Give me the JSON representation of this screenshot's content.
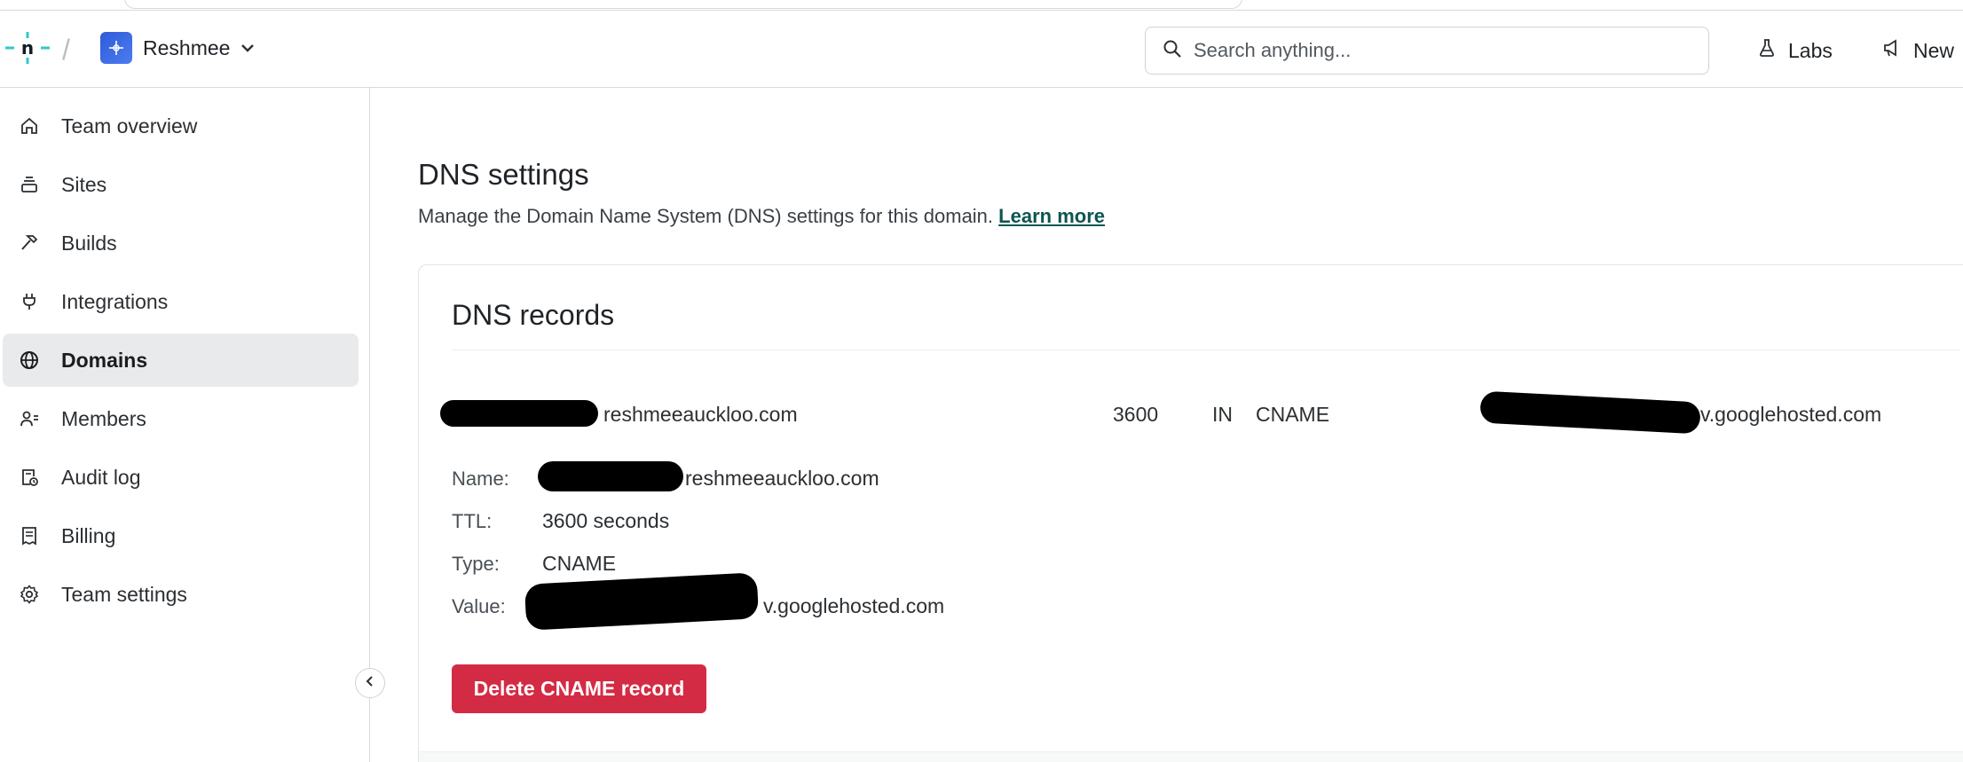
{
  "header": {
    "team_name": "Reshmee",
    "search_placeholder": "Search anything...",
    "labs_label": "Labs",
    "news_label": "New"
  },
  "sidebar": {
    "items": [
      {
        "label": "Team overview",
        "icon": "home-icon",
        "active": false
      },
      {
        "label": "Sites",
        "icon": "stack-icon",
        "active": false
      },
      {
        "label": "Builds",
        "icon": "hammer-icon",
        "active": false
      },
      {
        "label": "Integrations",
        "icon": "plug-icon",
        "active": false
      },
      {
        "label": "Domains",
        "icon": "globe-icon",
        "active": true
      },
      {
        "label": "Members",
        "icon": "members-icon",
        "active": false
      },
      {
        "label": "Audit log",
        "icon": "audit-log-icon",
        "active": false
      },
      {
        "label": "Billing",
        "icon": "receipt-icon",
        "active": false
      },
      {
        "label": "Team settings",
        "icon": "gear-icon",
        "active": false
      }
    ]
  },
  "main": {
    "title": "DNS settings",
    "description": "Manage the Domain Name System (DNS) settings for this domain.",
    "learn_more": "Learn more",
    "card": {
      "title": "DNS records",
      "record": {
        "name": "reshmeeauckloo.com",
        "ttl": "3600",
        "class": "IN",
        "type": "CNAME",
        "value": "v.googlehosted.com"
      },
      "details": {
        "name_label": "Name:",
        "name_value": "reshmeeauckloo.com",
        "ttl_label": "TTL:",
        "ttl_value": "3600 seconds",
        "type_label": "Type:",
        "type_value": "CNAME",
        "value_label": "Value:",
        "value_value": "v.googlehosted.com"
      },
      "delete_button": "Delete CNAME record"
    }
  },
  "colors": {
    "brand_teal": "#30c8c9",
    "danger": "#d42b45",
    "link": "#0d5550",
    "active_nav_bg": "#e9eaeb"
  }
}
